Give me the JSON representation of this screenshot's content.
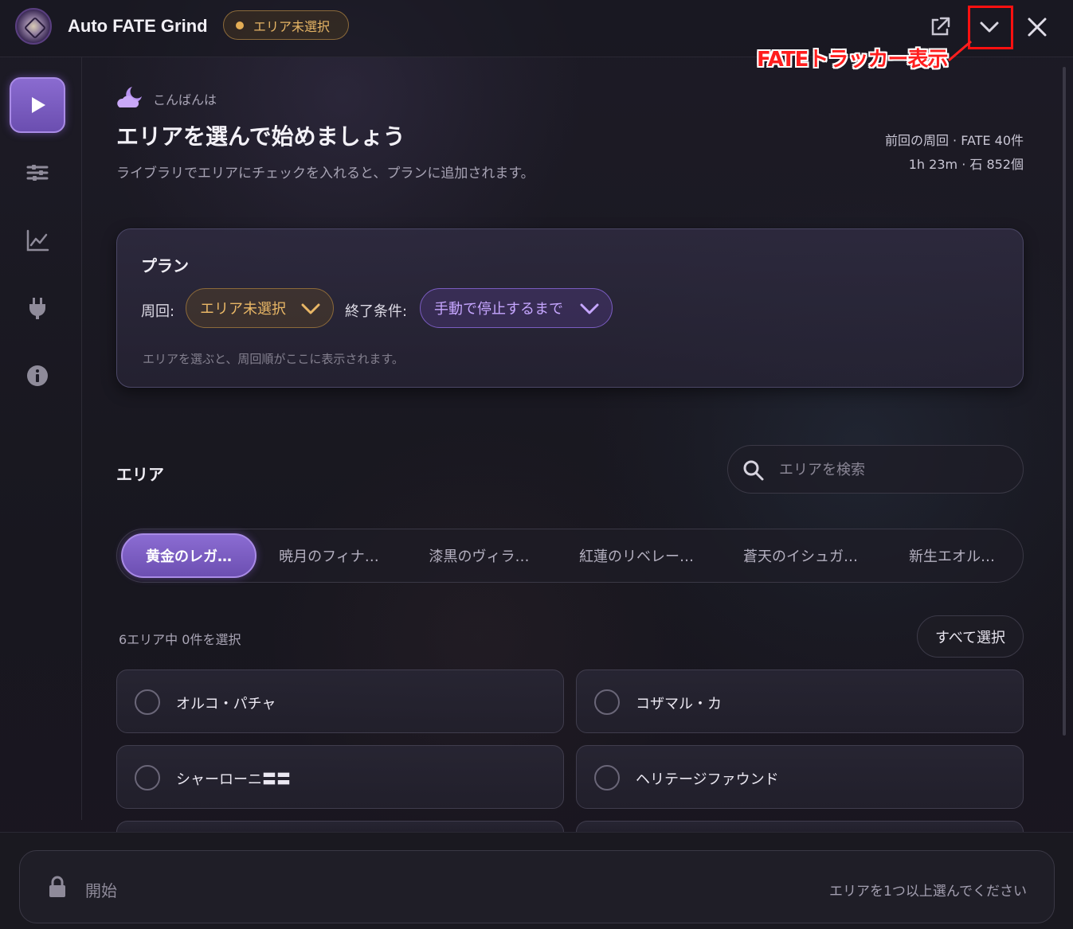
{
  "app": {
    "title": "Auto FATE Grind",
    "status": "エリア未選択",
    "status_color": "#e3ad55",
    "accent": "#7c5cc4"
  },
  "titlebar": {
    "icons": [
      "external-link-icon",
      "chevron-down-icon",
      "close-icon"
    ]
  },
  "annotation": {
    "text": "FATEトラッカー表示",
    "color": "#ff1e1e"
  },
  "sidebar": {
    "items": [
      {
        "name": "play",
        "icon": "play-icon",
        "active": true
      },
      {
        "name": "settings",
        "icon": "sliders-icon",
        "active": false
      },
      {
        "name": "stats",
        "icon": "chart-icon",
        "active": false
      },
      {
        "name": "plugins",
        "icon": "plug-icon",
        "active": false
      },
      {
        "name": "info",
        "icon": "info-icon",
        "active": false
      }
    ]
  },
  "greeting": {
    "small": "こんばんは",
    "headline": "エリアを選んで始めましょう",
    "sub": "ライブラリでエリアにチェックを入れると、プランに追加されます。"
  },
  "last_run": {
    "line1": "前回の周回 · FATE 40件",
    "line2": "1h 23m · 石 852個"
  },
  "plan": {
    "title": "プラン",
    "loop_label": "周回:",
    "loop_value": "エリア未選択",
    "end_label": "終了条件:",
    "end_value": "手動で停止するまで",
    "hint": "エリアを選ぶと、周回順がここに表示されます。"
  },
  "areas": {
    "heading": "エリア",
    "search_placeholder": "エリアを検索",
    "tabs": [
      "黄金のレガ…",
      "暁月のフィナ…",
      "漆黒のヴィラ…",
      "紅蓮のリベレー…",
      "蒼天のイシュガ…",
      "新生エオル…"
    ],
    "active_tab": 0,
    "count_text": "6エリア中 0件を選択",
    "select_all": "すべて選択",
    "list": [
      "オルコ・パチャ",
      "コザマル・カ",
      "シャーローニ〓〓",
      "ヘリテージファウンド"
    ]
  },
  "footer": {
    "start_label": "開始",
    "start_hint": "エリアを1つ以上選んでください"
  }
}
